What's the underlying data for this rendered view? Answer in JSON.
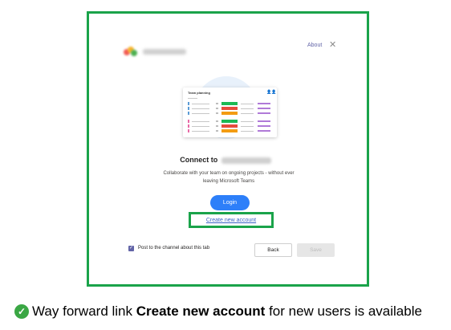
{
  "dialog": {
    "brand_icon": "app-logo-blurred",
    "about_label": "About",
    "close_icon": "close-icon",
    "preview": {
      "card_title": "Team planning",
      "avatars": "👤👤",
      "rows": [
        {
          "accent": "#5b9bd5",
          "status": "#1db954"
        },
        {
          "accent": "#5b9bd5",
          "status": "#e74c3c"
        },
        {
          "accent": "#5b9bd5",
          "status": "#f39c12"
        },
        {
          "accent": "#e86aa6",
          "status": "#1db954"
        },
        {
          "accent": "#e86aa6",
          "status": "#e74c3c"
        },
        {
          "accent": "#e86aa6",
          "status": "#f39c12"
        }
      ]
    },
    "connect_prefix": "Connect to",
    "description_line1": "Collaborate with your team on ongoing projects - without ever",
    "description_line2": "leaving Microsoft Teams",
    "login_label": "Login",
    "create_account_label": "Create new account",
    "post_checkbox_label": "Post to the channel about this tab",
    "back_label": "Back",
    "save_label": "Save"
  },
  "caption": {
    "icon": "checkmark-icon",
    "prefix": "Way forward link ",
    "bold": "Create new account",
    "suffix": " for new users is available"
  },
  "colors": {
    "highlight_border": "#1aa34a",
    "primary_button": "#2d7ff9",
    "teams_purple": "#6264a7",
    "link": "#3b63c4"
  }
}
